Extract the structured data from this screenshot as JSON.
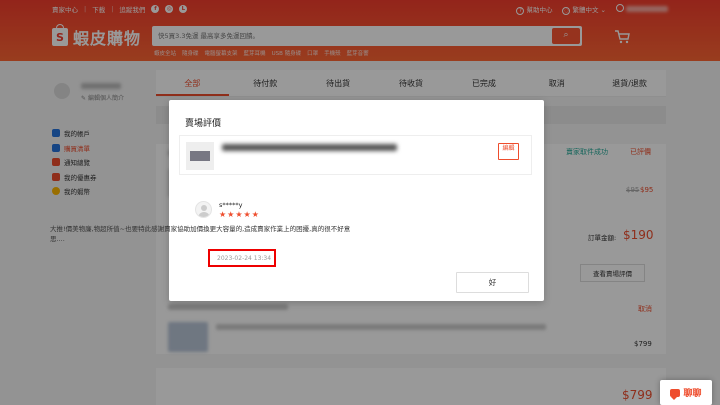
{
  "header": {
    "seller_center": "賣家中心",
    "download": "下載",
    "follow_us": "追蹤我們",
    "social_icons": [
      "facebook-icon",
      "instagram-icon",
      "line-icon"
    ],
    "help": "幫助中心",
    "language": "繁體中文",
    "logo_text": "蝦皮購物",
    "search_placeholder": "快5買3.3免運 最高享多免運回饋。",
    "search_hints": [
      "蝦皮全站",
      "隨身碟",
      "電腦螢幕支架",
      "藍芽耳機",
      "USB 隨身碟",
      "口罩",
      "手機殼",
      "藍芽音響"
    ],
    "brand_color": "#ee4d2d"
  },
  "sidebar": {
    "edit_profile": "編輯個人簡介",
    "items": [
      {
        "label": "我的帳戶",
        "icon": "user-icon",
        "color": "#2673dd"
      },
      {
        "label": "購買清單",
        "icon": "clipboard-icon",
        "color": "#2673dd",
        "active": true
      },
      {
        "label": "通知總覽",
        "icon": "bell-icon",
        "color": "#ee4d2d"
      },
      {
        "label": "我的優惠券",
        "icon": "coupon-icon",
        "color": "#ee4d2d"
      },
      {
        "label": "我的蝦幣",
        "icon": "coin-icon",
        "color": "#ffb800"
      }
    ]
  },
  "tabs": [
    "全部",
    "待付款",
    "待出貨",
    "待收貨",
    "已完成",
    "取消",
    "退貨/退款"
  ],
  "orders": {
    "status": "賣家取件成功",
    "rated": "已評價",
    "old_price": "$95",
    "price": "$95",
    "total_label": "訂單金額:",
    "total": "$190",
    "view_rating": "查看賣場評價",
    "cancel": "取消",
    "price2": "$799",
    "total2": "$799"
  },
  "modal": {
    "title": "賣場評價",
    "edit": "編輯",
    "reviewer": "s*****y",
    "stars": 5,
    "review_text": "大推!價美物廉,物超所值~也要特此感謝賣家協助加價換更大容量的,造成賣家作業上的困擾,真的很不好意思....",
    "date": "2023-02-24 13:34",
    "ok": "好"
  },
  "chat": {
    "label": "聊聊"
  }
}
